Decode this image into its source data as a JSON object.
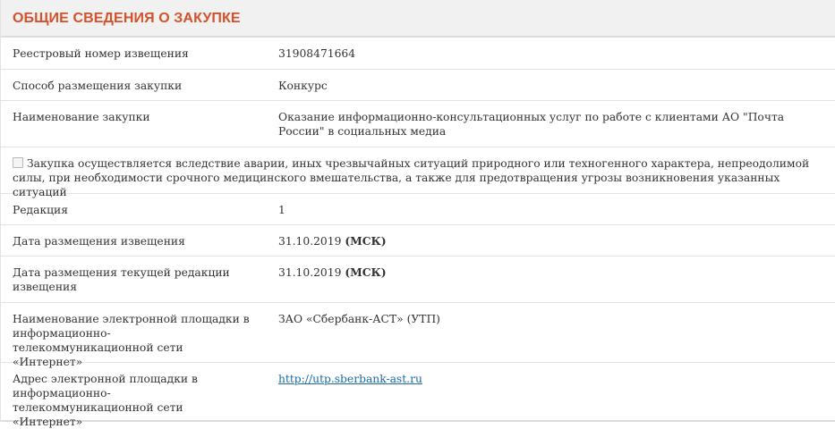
{
  "section": {
    "title": "ОБЩИЕ СВЕДЕНИЯ О ЗАКУПКЕ"
  },
  "rows": {
    "registry_number": {
      "label": "Реестровый номер извещения",
      "value": "31908471664"
    },
    "method": {
      "label": "Способ размещения закупки",
      "value": "Конкурс"
    },
    "name": {
      "label": "Наименование закупки",
      "value": "Оказание информационно-консультационных услуг по работе с клиентами АО \"Почта России\" в социальных медиа"
    },
    "emergency": {
      "checked": false,
      "label": "Закупка осуществляется вследствие аварии, иных чрезвычайных ситуаций природного или техногенного характера, непреодолимой силы, при необходимости срочного медицинского вмешательства, а также для предотвращения угрозы возникновения указанных ситуаций"
    },
    "edition": {
      "label": "Редакция",
      "value": "1"
    },
    "notice_date": {
      "label": "Дата размещения извещения",
      "value": "31.10.2019",
      "tz": "(МСК)"
    },
    "edition_date": {
      "label": "Дата размещения текущей редакции извещения",
      "value": "31.10.2019",
      "tz": "(МСК)"
    },
    "platform_name": {
      "label": "Наименование электронной площадки в информационно-телекоммуникационной сети «Интернет»",
      "value": "ЗАО «Сбербанк-АСТ» (УТП)"
    },
    "platform_url": {
      "label": "Адрес электронной площадки в информационно-телекоммуникационной сети «Интернет»",
      "value": "http://utp.sberbank-ast.ru"
    }
  }
}
